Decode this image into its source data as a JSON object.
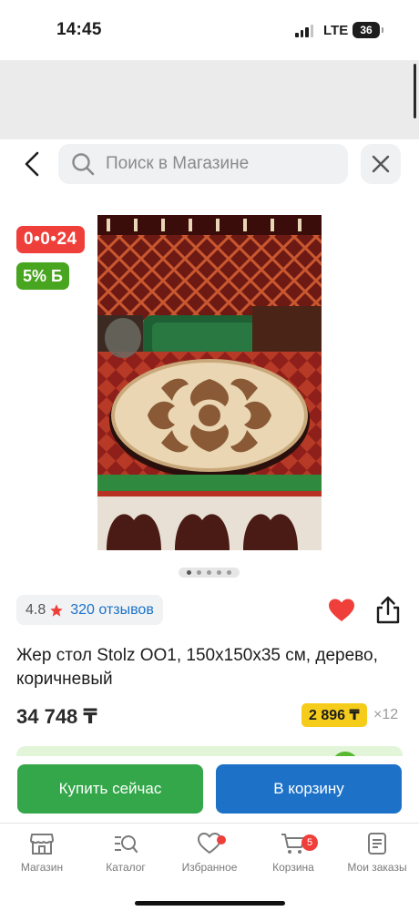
{
  "status_bar": {
    "time": "14:45",
    "network": "LTE",
    "battery": "36"
  },
  "header": {
    "search_placeholder": "Поиск в Магазине"
  },
  "badges": {
    "timer": "0•0•24",
    "bonus": "5% Б"
  },
  "product": {
    "image_alt": "Жер стол Stolz OO1",
    "rating": "4.8",
    "reviews": "320 отзывов",
    "title": "Жер стол Stolz OO1, 150x150x35 см, дерево, коричневый",
    "price": "34 748 ₸",
    "installment_price": "2 896 ₸",
    "installment_term": "×12",
    "is_favorite": true
  },
  "carousel": {
    "total": 5,
    "active": 1
  },
  "actions": {
    "buy_now": "Купить сейчас",
    "add_to_cart": "В корзину"
  },
  "tab_bar": {
    "items": [
      {
        "label": "Магазин",
        "icon": "store-icon"
      },
      {
        "label": "Каталог",
        "icon": "catalog-search-icon"
      },
      {
        "label": "Избранное",
        "icon": "heart-icon"
      },
      {
        "label": "Корзина",
        "icon": "cart-icon",
        "badge": "5"
      },
      {
        "label": "Мои заказы",
        "icon": "orders-icon"
      }
    ]
  },
  "colors": {
    "accent_red": "#ef3f3a",
    "bonus_green": "#48a51f",
    "buy_green": "#33a74a",
    "cart_blue": "#1d72c8",
    "link_blue": "#1a73c8",
    "installment_yellow": "#f6cc1b"
  }
}
